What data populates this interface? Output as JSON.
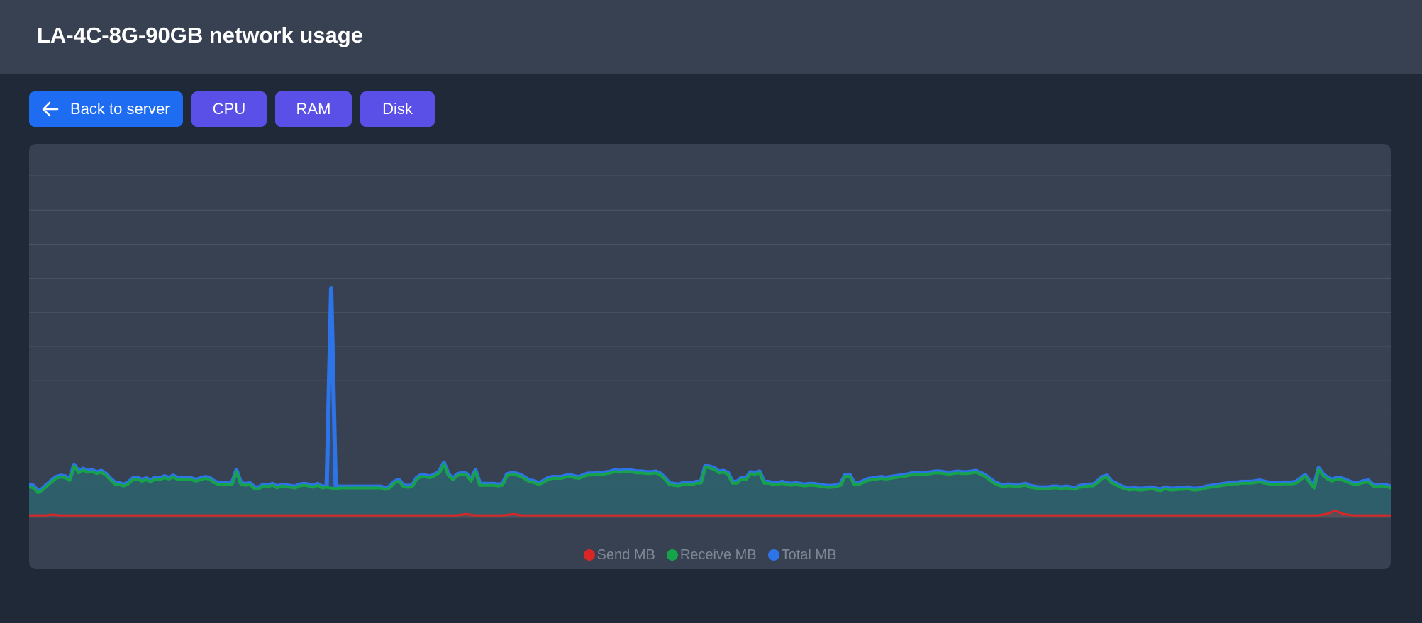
{
  "header": {
    "title": "LA-4C-8G-90GB network usage"
  },
  "toolbar": {
    "back_label": "Back to server",
    "back_icon": "arrow-left-icon",
    "cpu_label": "CPU",
    "ram_label": "RAM",
    "disk_label": "Disk"
  },
  "colors": {
    "page_bg": "#1f2937",
    "card_bg": "#374151",
    "back_button": "#1d6cf2",
    "metric_button": "#5a50e8",
    "send": "#dc2626",
    "receive": "#16a34a",
    "total": "#2d74e8"
  },
  "chart_data": {
    "type": "area",
    "title": "",
    "xlabel": "",
    "ylabel": "",
    "ylim": [
      0,
      10
    ],
    "grid": true,
    "gridlines": 11,
    "axis_labels_visible": false,
    "legend_placement": "bottom-center",
    "series": [
      {
        "name": "Send MB",
        "color": "#dc2626",
        "values": [
          0.06,
          0.06,
          0.06,
          0.06,
          0.06,
          0.08,
          0.08,
          0.06,
          0.06,
          0.06,
          0.06,
          0.06,
          0.06,
          0.06,
          0.06,
          0.06,
          0.06,
          0.06,
          0.06,
          0.06,
          0.06,
          0.06,
          0.06,
          0.06,
          0.06,
          0.06,
          0.06,
          0.06,
          0.06,
          0.06,
          0.06,
          0.06,
          0.06,
          0.06,
          0.06,
          0.06,
          0.06,
          0.06,
          0.06,
          0.06,
          0.06,
          0.06,
          0.06,
          0.06,
          0.06,
          0.06,
          0.06,
          0.06,
          0.06,
          0.06,
          0.06,
          0.06,
          0.06,
          0.06,
          0.06,
          0.06,
          0.06,
          0.06,
          0.06,
          0.06,
          0.06,
          0.06,
          0.06,
          0.06,
          0.06,
          0.06,
          0.06,
          0.06,
          0.06,
          0.06,
          0.06,
          0.06,
          0.06,
          0.06,
          0.06,
          0.06,
          0.06,
          0.06,
          0.06,
          0.06,
          0.06,
          0.06,
          0.06,
          0.06,
          0.06,
          0.06,
          0.06,
          0.06,
          0.06,
          0.06,
          0.06,
          0.06,
          0.06,
          0.06,
          0.06,
          0.06,
          0.06,
          0.06,
          0.06,
          0.06,
          0.06,
          0.08,
          0.1,
          0.08,
          0.06,
          0.06,
          0.06,
          0.06,
          0.06,
          0.06,
          0.06,
          0.06,
          0.08,
          0.1,
          0.08,
          0.06,
          0.06,
          0.06,
          0.06,
          0.06,
          0.06,
          0.06,
          0.06,
          0.06,
          0.06,
          0.06,
          0.06,
          0.06,
          0.06,
          0.06,
          0.06,
          0.06,
          0.06,
          0.06,
          0.06,
          0.06,
          0.06,
          0.06,
          0.06,
          0.06,
          0.06,
          0.06,
          0.06,
          0.06,
          0.06,
          0.06,
          0.06,
          0.06,
          0.06,
          0.06,
          0.06,
          0.06,
          0.06,
          0.06,
          0.06,
          0.06,
          0.06,
          0.06,
          0.06,
          0.06,
          0.06,
          0.06,
          0.06,
          0.06,
          0.06,
          0.06,
          0.06,
          0.06,
          0.06,
          0.06,
          0.06,
          0.06,
          0.06,
          0.06,
          0.06,
          0.06,
          0.06,
          0.06,
          0.06,
          0.06,
          0.06,
          0.06,
          0.06,
          0.06,
          0.06,
          0.06,
          0.06,
          0.06,
          0.06,
          0.06,
          0.06,
          0.06,
          0.06,
          0.06,
          0.06,
          0.06,
          0.06,
          0.06,
          0.06,
          0.06,
          0.06,
          0.06,
          0.06,
          0.06,
          0.06,
          0.06,
          0.06,
          0.06,
          0.06,
          0.06,
          0.06,
          0.06,
          0.06,
          0.06,
          0.06,
          0.06,
          0.06,
          0.06,
          0.06,
          0.06,
          0.06,
          0.06,
          0.06,
          0.06,
          0.06,
          0.06,
          0.06,
          0.06,
          0.06,
          0.06,
          0.06,
          0.06,
          0.06,
          0.06,
          0.06,
          0.06,
          0.06,
          0.06,
          0.06,
          0.06,
          0.06,
          0.06,
          0.06,
          0.06,
          0.06,
          0.06,
          0.06,
          0.06,
          0.06,
          0.06,
          0.06,
          0.06,
          0.06,
          0.06,
          0.06,
          0.06,
          0.06,
          0.06,
          0.06,
          0.06,
          0.06,
          0.06,
          0.06,
          0.06,
          0.06,
          0.06,
          0.06,
          0.06,
          0.06,
          0.06,
          0.06,
          0.06,
          0.06,
          0.06,
          0.06,
          0.06,
          0.06,
          0.06,
          0.06,
          0.06,
          0.06,
          0.06,
          0.06,
          0.06,
          0.06,
          0.06,
          0.06,
          0.06,
          0.06,
          0.06,
          0.06,
          0.06,
          0.06,
          0.06,
          0.06,
          0.06,
          0.06,
          0.06,
          0.06,
          0.06,
          0.06,
          0.06,
          0.08,
          0.1,
          0.15,
          0.2,
          0.15,
          0.1,
          0.08,
          0.06,
          0.06,
          0.06,
          0.06,
          0.06,
          0.06,
          0.06,
          0.06,
          0.06,
          0.06
        ]
      },
      {
        "name": "Receive MB",
        "color": "#16a34a",
        "values": [
          0.9,
          0.86,
          0.72,
          0.8,
          0.92,
          1.04,
          1.14,
          1.18,
          1.16,
          1.08,
          1.5,
          1.3,
          1.38,
          1.32,
          1.34,
          1.28,
          1.32,
          1.24,
          1.1,
          0.98,
          0.96,
          0.92,
          0.98,
          1.1,
          1.12,
          1.06,
          1.1,
          1.04,
          1.12,
          1.1,
          1.16,
          1.12,
          1.18,
          1.1,
          1.12,
          1.1,
          1.1,
          1.06,
          1.1,
          1.14,
          1.12,
          1.02,
          0.96,
          0.96,
          0.96,
          0.96,
          1.34,
          0.96,
          0.94,
          0.96,
          0.84,
          0.84,
          0.92,
          0.9,
          0.94,
          0.86,
          0.92,
          0.9,
          0.88,
          0.86,
          0.92,
          0.94,
          0.92,
          0.88,
          0.94,
          0.86,
          0.88,
          0.86,
          0.84,
          0.86,
          0.86,
          0.86,
          0.86,
          0.86,
          0.86,
          0.86,
          0.86,
          0.86,
          0.86,
          0.82,
          0.86,
          1.0,
          1.06,
          0.9,
          0.88,
          0.9,
          1.12,
          1.2,
          1.18,
          1.16,
          1.22,
          1.3,
          1.56,
          1.22,
          1.1,
          1.22,
          1.26,
          1.24,
          1.06,
          1.34,
          0.94,
          0.94,
          0.94,
          0.94,
          0.92,
          0.94,
          1.22,
          1.26,
          1.24,
          1.2,
          1.12,
          1.04,
          1.02,
          0.96,
          1.02,
          1.1,
          1.14,
          1.14,
          1.14,
          1.18,
          1.2,
          1.16,
          1.14,
          1.2,
          1.24,
          1.24,
          1.26,
          1.24,
          1.28,
          1.3,
          1.34,
          1.32,
          1.34,
          1.34,
          1.32,
          1.3,
          1.3,
          1.28,
          1.28,
          1.3,
          1.24,
          1.12,
          0.96,
          0.94,
          0.92,
          0.96,
          0.96,
          0.96,
          1.0,
          1.0,
          1.48,
          1.44,
          1.4,
          1.3,
          1.32,
          1.26,
          1.0,
          1.0,
          1.12,
          1.1,
          1.28,
          1.26,
          1.3,
          1.0,
          1.0,
          0.96,
          0.96,
          1.0,
          0.96,
          0.94,
          0.96,
          0.94,
          0.92,
          0.94,
          0.94,
          0.92,
          0.9,
          0.88,
          0.88,
          0.9,
          0.94,
          1.2,
          1.2,
          0.96,
          0.96,
          1.02,
          1.08,
          1.1,
          1.12,
          1.14,
          1.12,
          1.14,
          1.16,
          1.18,
          1.2,
          1.22,
          1.26,
          1.26,
          1.24,
          1.26,
          1.28,
          1.3,
          1.3,
          1.28,
          1.26,
          1.28,
          1.3,
          1.28,
          1.28,
          1.3,
          1.32,
          1.26,
          1.2,
          1.1,
          1.0,
          0.94,
          0.9,
          0.92,
          0.92,
          0.9,
          0.92,
          0.94,
          0.88,
          0.86,
          0.84,
          0.84,
          0.84,
          0.86,
          0.86,
          0.84,
          0.86,
          0.84,
          0.82,
          0.88,
          0.9,
          0.92,
          0.92,
          1.02,
          1.14,
          1.18,
          1.02,
          0.96,
          0.88,
          0.84,
          0.8,
          0.82,
          0.8,
          0.8,
          0.82,
          0.84,
          0.8,
          0.78,
          0.84,
          0.8,
          0.8,
          0.82,
          0.82,
          0.84,
          0.8,
          0.8,
          0.82,
          0.86,
          0.88,
          0.9,
          0.92,
          0.94,
          0.96,
          0.98,
          0.98,
          1.0,
          1.0,
          1.0,
          1.02,
          1.04,
          1.0,
          0.98,
          0.96,
          0.96,
          0.98,
          0.98,
          0.98,
          1.0,
          1.1,
          1.2,
          1.02,
          0.86,
          1.4,
          1.22,
          1.12,
          1.06,
          1.12,
          1.1,
          1.06,
          1.0,
          0.96,
          0.98,
          1.02,
          1.04,
          0.92,
          0.9,
          0.92,
          0.9,
          0.86
        ]
      },
      {
        "name": "Total MB",
        "color": "#2d74e8",
        "values": [
          0.96,
          0.92,
          0.76,
          0.84,
          0.96,
          1.08,
          1.18,
          1.22,
          1.2,
          1.12,
          1.54,
          1.34,
          1.42,
          1.36,
          1.38,
          1.32,
          1.36,
          1.28,
          1.14,
          1.02,
          1.0,
          0.96,
          1.02,
          1.14,
          1.16,
          1.1,
          1.14,
          1.08,
          1.16,
          1.14,
          1.2,
          1.16,
          1.22,
          1.14,
          1.16,
          1.14,
          1.14,
          1.1,
          1.14,
          1.18,
          1.16,
          1.06,
          1.0,
          1.0,
          1.0,
          1.0,
          1.38,
          1.0,
          0.98,
          1.0,
          0.88,
          0.88,
          0.96,
          0.94,
          0.98,
          0.9,
          0.96,
          0.94,
          0.92,
          0.9,
          0.96,
          0.98,
          0.96,
          0.92,
          0.98,
          0.9,
          0.92,
          6.7,
          0.9,
          0.9,
          0.9,
          0.9,
          0.9,
          0.9,
          0.9,
          0.9,
          0.9,
          0.9,
          0.9,
          0.86,
          0.9,
          1.04,
          1.1,
          0.94,
          0.92,
          0.94,
          1.16,
          1.24,
          1.22,
          1.2,
          1.26,
          1.34,
          1.6,
          1.26,
          1.14,
          1.26,
          1.3,
          1.28,
          1.1,
          1.38,
          0.98,
          0.98,
          0.98,
          0.98,
          0.96,
          0.98,
          1.26,
          1.3,
          1.28,
          1.24,
          1.16,
          1.08,
          1.06,
          1.0,
          1.06,
          1.14,
          1.18,
          1.18,
          1.18,
          1.22,
          1.24,
          1.2,
          1.18,
          1.24,
          1.28,
          1.28,
          1.3,
          1.28,
          1.32,
          1.34,
          1.38,
          1.36,
          1.38,
          1.38,
          1.36,
          1.34,
          1.34,
          1.32,
          1.32,
          1.34,
          1.28,
          1.16,
          1.0,
          0.98,
          0.96,
          1.0,
          1.0,
          1.0,
          1.04,
          1.04,
          1.52,
          1.48,
          1.44,
          1.34,
          1.36,
          1.3,
          1.04,
          1.04,
          1.16,
          1.14,
          1.32,
          1.3,
          1.34,
          1.04,
          1.04,
          1.0,
          1.0,
          1.04,
          1.0,
          0.98,
          1.0,
          0.98,
          0.96,
          0.98,
          0.98,
          0.96,
          0.94,
          0.92,
          0.92,
          0.94,
          0.98,
          1.24,
          1.24,
          1.0,
          1.0,
          1.06,
          1.12,
          1.14,
          1.16,
          1.18,
          1.16,
          1.18,
          1.2,
          1.22,
          1.24,
          1.26,
          1.3,
          1.3,
          1.28,
          1.3,
          1.32,
          1.34,
          1.34,
          1.32,
          1.3,
          1.32,
          1.34,
          1.32,
          1.32,
          1.34,
          1.36,
          1.3,
          1.24,
          1.14,
          1.04,
          0.98,
          0.94,
          0.96,
          0.96,
          0.94,
          0.96,
          0.98,
          0.92,
          0.9,
          0.88,
          0.88,
          0.88,
          0.9,
          0.9,
          0.88,
          0.9,
          0.88,
          0.86,
          0.92,
          0.94,
          0.96,
          0.96,
          1.06,
          1.18,
          1.22,
          1.06,
          1.0,
          0.92,
          0.88,
          0.84,
          0.86,
          0.84,
          0.84,
          0.86,
          0.88,
          0.84,
          0.82,
          0.88,
          0.84,
          0.84,
          0.86,
          0.86,
          0.88,
          0.84,
          0.84,
          0.86,
          0.9,
          0.92,
          0.94,
          0.96,
          0.98,
          1.0,
          1.02,
          1.02,
          1.04,
          1.04,
          1.04,
          1.06,
          1.08,
          1.04,
          1.02,
          1.0,
          1.0,
          1.02,
          1.02,
          1.02,
          1.04,
          1.14,
          1.24,
          1.06,
          0.9,
          1.44,
          1.26,
          1.16,
          1.1,
          1.16,
          1.14,
          1.1,
          1.04,
          1.0,
          1.02,
          1.06,
          1.08,
          0.96,
          0.94,
          0.96,
          0.94,
          0.9
        ]
      }
    ]
  }
}
